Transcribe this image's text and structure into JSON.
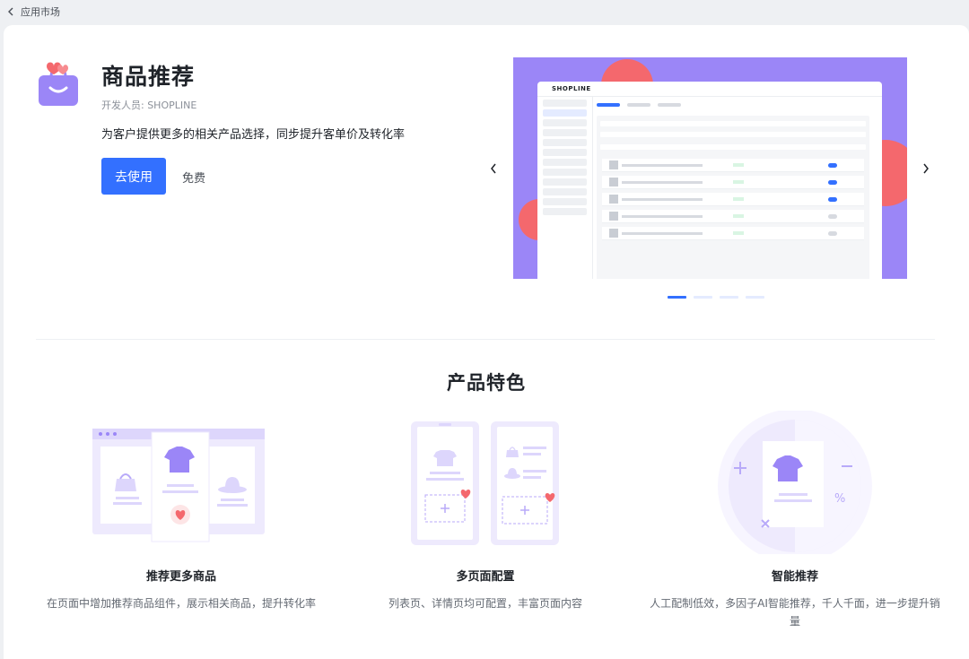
{
  "topbar": {
    "title": "应用市场"
  },
  "app": {
    "name": "商品推荐",
    "developer": "开发人员: SHOPLINE",
    "description": "为客户提供更多的相关产品选择，同步提升客单价及转化率",
    "primary_action": "去使用",
    "price": "免费"
  },
  "carousel": {
    "logo": "SHOPLINE",
    "active_index": 0,
    "slide_count": 4
  },
  "features": {
    "title": "产品特色",
    "items": [
      {
        "name": "推荐更多商品",
        "description": "在页面中增加推荐商品组件，展示相关商品，提升转化率"
      },
      {
        "name": "多页面配置",
        "description": "列表页、详情页均可配置，丰富页面内容"
      },
      {
        "name": "智能推荐",
        "description": "人工配制低效，多因子AI智能推荐，千人千面，进一步提升销量"
      }
    ]
  },
  "colors": {
    "accent": "#3370ff",
    "heart": "#f4686d",
    "illustration": "#9b86f7"
  }
}
